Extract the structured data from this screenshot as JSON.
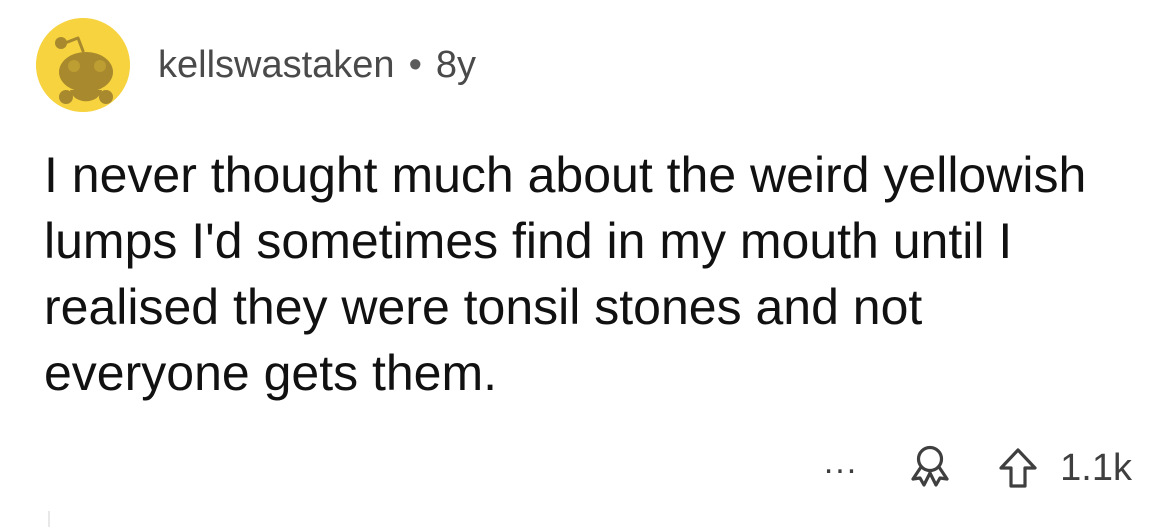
{
  "comment": {
    "author": "kellswastaken",
    "separator": "•",
    "age": "8y",
    "text": "I never thought much about the weird yellowish lumps I'd sometimes find in my mouth until I realised they were tonsil stones and not everyone gets them.",
    "actions": {
      "more_label": "...",
      "score": "1.1k",
      "icons": [
        "snoo-avatar-icon",
        "award-icon",
        "upvote-arrow-icon"
      ]
    }
  },
  "colors": {
    "avatar_background": "#f6d33f",
    "avatar_figure": "#a8892d",
    "text": "#111111",
    "meta": "#4a4a4a"
  }
}
